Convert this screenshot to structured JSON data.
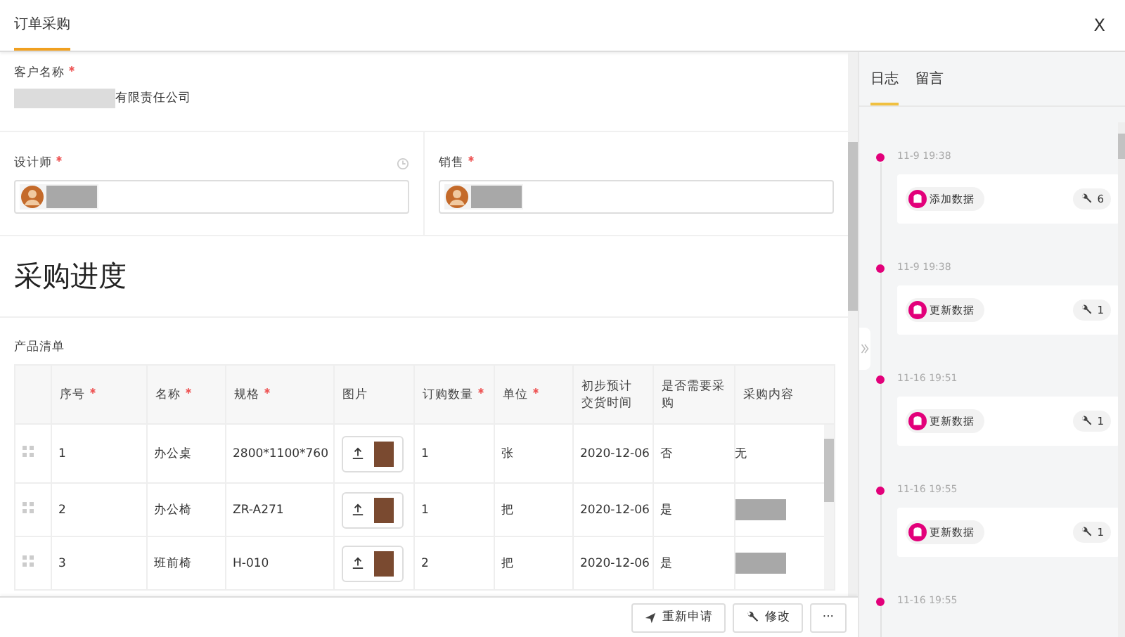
{
  "header": {
    "tab": {
      "label": "订单采购",
      "selected": true
    },
    "close": "X"
  },
  "customer": {
    "label": "客户名称",
    "required": true,
    "value": "有限责任公司"
  },
  "people": [
    {
      "label": "设计师",
      "required": true,
      "history_icon": true
    },
    {
      "label": "销售",
      "required": true,
      "history_icon": false
    }
  ],
  "progress_title": "采购进度",
  "list_title": "产品清单",
  "table": {
    "columns": [
      {
        "label": "序号",
        "required": true
      },
      {
        "label": "名称",
        "required": true
      },
      {
        "label": "规格",
        "required": true
      },
      {
        "label": "图片",
        "required": false
      },
      {
        "label": "订购数量",
        "required": true
      },
      {
        "label": "单位",
        "required": true
      },
      {
        "label": "初步预计交货时间",
        "required": false
      },
      {
        "label": "是否需要采购",
        "required": false
      },
      {
        "label": "采购内容",
        "required": false
      }
    ],
    "rows": [
      {
        "index": "1",
        "name": "办公桌",
        "spec": "2800*1100*760",
        "qty": "1",
        "unit": "张",
        "date": "2020-12-06",
        "need": "否",
        "content": {
          "kind": "text",
          "text": "无"
        }
      },
      {
        "index": "2",
        "name": "办公椅",
        "spec": "ZR-A271",
        "qty": "1",
        "unit": "把",
        "date": "2020-12-06",
        "need": "是",
        "content": {
          "kind": "redacted"
        }
      },
      {
        "index": "3",
        "name": "班前椅",
        "spec": "H-010",
        "qty": "2",
        "unit": "把",
        "date": "2020-12-06",
        "need": "是",
        "content": {
          "kind": "redacted"
        }
      }
    ]
  },
  "actions": [
    {
      "kind": "send",
      "label": "重新申请"
    },
    {
      "kind": "edit",
      "label": "修改"
    },
    {
      "kind": "more",
      "label": "···"
    }
  ],
  "log": {
    "tabs": [
      {
        "label": "日志",
        "selected": true
      },
      {
        "label": "留言",
        "selected": false
      }
    ],
    "entries": [
      {
        "time": "11-9 19:38",
        "action": "添加数据",
        "count": "6"
      },
      {
        "time": "11-9 19:38",
        "action": "更新数据",
        "count": "1"
      },
      {
        "time": "11-16 19:51",
        "action": "更新数据",
        "count": "1"
      },
      {
        "time": "11-16 19:55",
        "action": "更新数据",
        "count": "1"
      },
      {
        "time": "11-16 19:55"
      }
    ]
  }
}
